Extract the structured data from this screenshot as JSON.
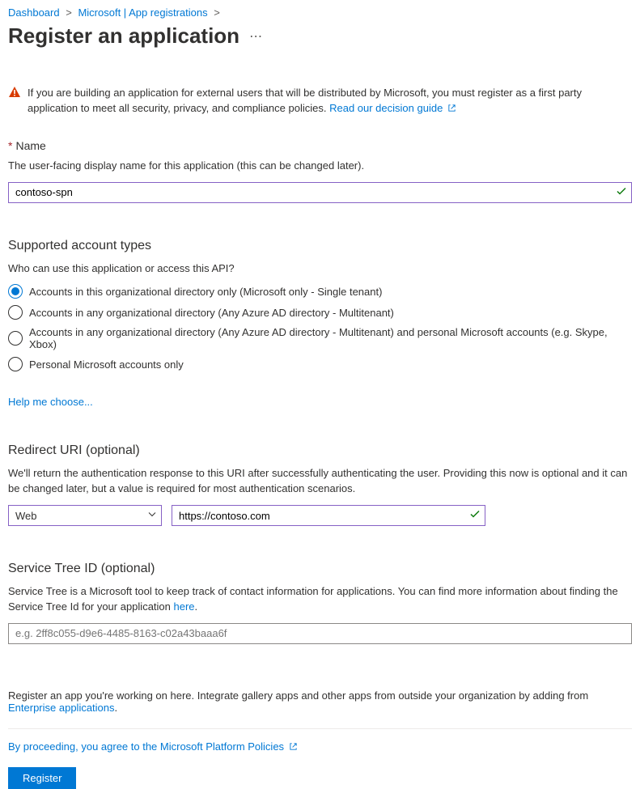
{
  "breadcrumb": {
    "dashboard": "Dashboard",
    "app_registrations": "Microsoft | App registrations"
  },
  "page_title": "Register an application",
  "alert": {
    "text_prefix": "If you are building an application for external users that will be distributed by Microsoft, you must register as a first party application to meet all security, privacy, and compliance policies. ",
    "link_label": "Read our decision guide"
  },
  "name": {
    "label": "Name",
    "helper": "The user-facing display name for this application (this can be changed later).",
    "value": "contoso-spn"
  },
  "account_types": {
    "heading": "Supported account types",
    "helper": "Who can use this application or access this API?",
    "options": [
      "Accounts in this organizational directory only (Microsoft only - Single tenant)",
      "Accounts in any organizational directory (Any Azure AD directory - Multitenant)",
      "Accounts in any organizational directory (Any Azure AD directory - Multitenant) and personal Microsoft accounts (e.g. Skype, Xbox)",
      "Personal Microsoft accounts only"
    ],
    "selected_index": 0,
    "help_link": "Help me choose..."
  },
  "redirect": {
    "heading": "Redirect URI (optional)",
    "helper": "We'll return the authentication response to this URI after successfully authenticating the user. Providing this now is optional and it can be changed later, but a value is required for most authentication scenarios.",
    "platform": "Web",
    "uri_value": "https://contoso.com"
  },
  "service_tree": {
    "heading": "Service Tree ID (optional)",
    "helper_prefix": "Service Tree is a Microsoft tool to keep track of contact information for applications. You can find more information about finding the Service Tree Id for your application ",
    "helper_link": "here",
    "placeholder": "e.g. 2ff8c055-d9e6-4485-8163-c02a43baaa6f"
  },
  "footer": {
    "note_prefix": "Register an app you're working on here. Integrate gallery apps and other apps from outside your organization by adding from ",
    "note_link": "Enterprise applications",
    "policy_label": "By proceeding, you agree to the Microsoft Platform Policies",
    "register_button": "Register"
  }
}
